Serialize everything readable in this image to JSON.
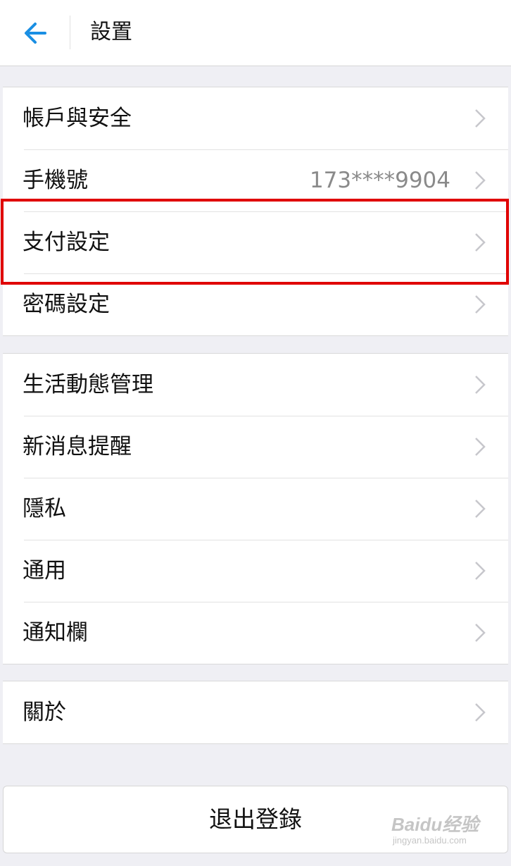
{
  "header": {
    "title": "設置",
    "back_icon": "arrow-left-icon",
    "accent_color": "#1a8fe3"
  },
  "groups": [
    {
      "rows": [
        {
          "label": "帳戶與安全",
          "value": ""
        },
        {
          "label": "手機號",
          "value": "173****9904"
        },
        {
          "label": "支付設定",
          "value": ""
        },
        {
          "label": "密碼設定",
          "value": ""
        }
      ]
    },
    {
      "rows": [
        {
          "label": "生活動態管理"
        },
        {
          "label": "新消息提醒"
        },
        {
          "label": "隱私"
        },
        {
          "label": "通用"
        },
        {
          "label": "通知欄"
        }
      ]
    },
    {
      "rows": [
        {
          "label": "關於"
        }
      ]
    }
  ],
  "logout_label": "退出登錄",
  "highlight_color": "#e00000",
  "watermark": {
    "brand": "Baidu经验",
    "url": "jingyan.baidu.com"
  }
}
